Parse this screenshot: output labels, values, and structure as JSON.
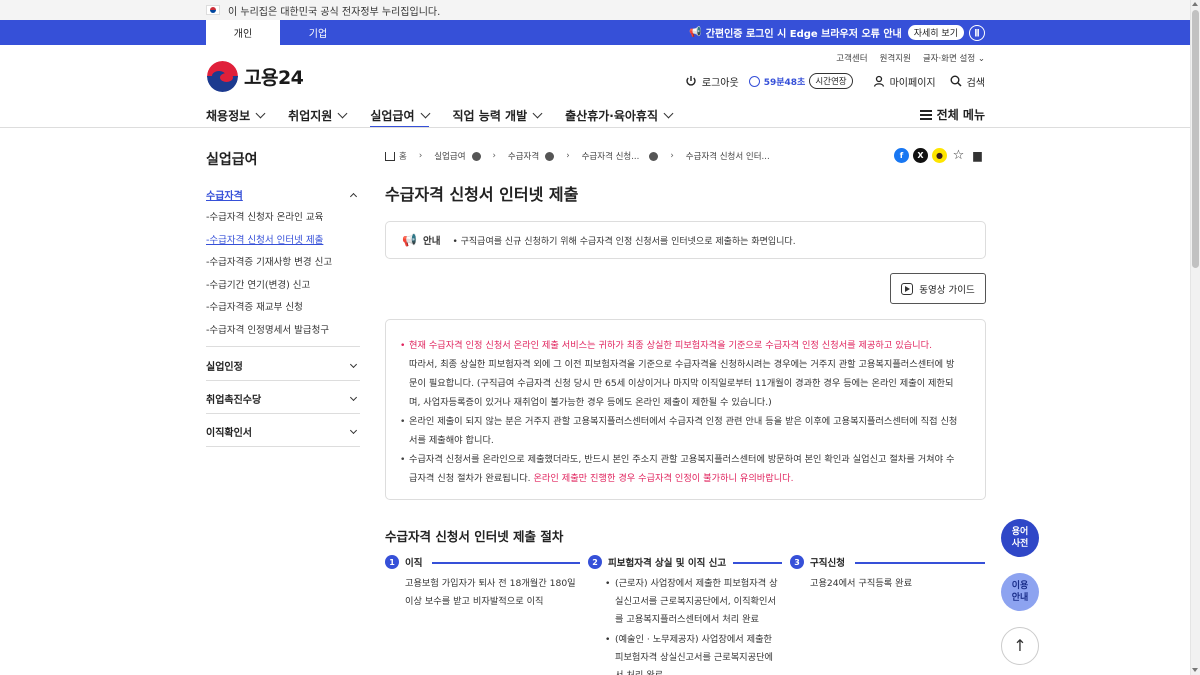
{
  "gov_banner": {
    "text": "이 누리집은 대한민국 공식 전자정부 누리집입니다."
  },
  "top_tabs": {
    "personal": "개인",
    "corporate": "기업"
  },
  "notice": {
    "text": "간편인증 로그인 시 Edge 브라우저 오류 안내",
    "detail_button": "자세히 보기",
    "pause_icon": "pause-icon"
  },
  "logo": {
    "text": "고용24"
  },
  "util_links": [
    "고객센터",
    "원격지원",
    "글자·화면 설정"
  ],
  "util": {
    "logout": "로그아웃",
    "timer": "59분48초",
    "extend": "시간연장",
    "mypage": "마이페이지",
    "search": "검색"
  },
  "main_nav": [
    {
      "label": "채용정보",
      "active": false
    },
    {
      "label": "취업지원",
      "active": false
    },
    {
      "label": "실업급여",
      "active": true
    },
    {
      "label": "직업 능력 개발",
      "active": false
    },
    {
      "label": "출산휴가·육아휴직",
      "active": false
    }
  ],
  "all_menu": "전체 메뉴",
  "sidebar": {
    "title": "실업급여",
    "sections": [
      {
        "label": "수급자격",
        "expanded": true
      },
      {
        "label": "실업인정",
        "expanded": false
      },
      {
        "label": "취업촉진수당",
        "expanded": false
      },
      {
        "label": "이직확인서",
        "expanded": false
      }
    ],
    "sub_items": [
      "-수급자격 신청자 온라인 교육",
      "-수급자격 신청서 인터넷 제출",
      "-수급자격증 기재사항 변경 신고",
      "-수급기간 연기(변경) 신고",
      "-수급자격증 재교부 신청",
      "-수급자격 인정명세서 발급청구"
    ],
    "current_sub": 1
  },
  "breadcrumb": [
    "홈",
    "실업급여",
    "수급자격",
    "수급자격 신청...",
    "수급자격 신청서 인터..."
  ],
  "share_icons": [
    {
      "name": "facebook-icon",
      "glyph": "f",
      "color": "#1877f2"
    },
    {
      "name": "x-icon",
      "glyph": "X",
      "color": "#111111"
    },
    {
      "name": "kakao-icon",
      "glyph": "●",
      "color": "#fee500"
    },
    {
      "name": "star-icon",
      "glyph": "☆",
      "color": "#ffffff"
    },
    {
      "name": "print-icon",
      "glyph": "▆",
      "color": "#ffffff"
    }
  ],
  "page_title": "수급자격 신청서 인터넷 제출",
  "guide": {
    "label": "안내",
    "text": "• 구직급여를 신규 신청하기 위해 수급자격 인정 신청서를 인터넷으로 제출하는 화면입니다."
  },
  "video_button": "동영상 가이드",
  "info": {
    "p1_red": "현재 수급자격 인정 신청서 온라인 제출 서비스는 귀하가 최종 상실한 피보험자격을 기준으로 수급자격 인정 신청서를 제공하고 있습니다.",
    "p1_line2": "따라서, 최종 상실한 피보험자격 외에 그 이전 피보험자격을 기준으로 수급자격을 신청하시려는 경우에는 거주지 관할 고용복지플러스센터에 방",
    "p1_line3": "문이 필요합니다. (구직급여 수급자격 신청 당시 만 65세 이상이거나 마지막 이직일로부터 11개월이 경과한 경우 등에는 온라인 제출이 제한되",
    "p1_line4": "며, 사업자등록증이 있거나 재취업이 불가능한 경우 등에도 온라인 제출이 제한될 수 있습니다.)",
    "p2_line1": "온라인 제출이 되지 않는 분은 거주지 관할 고용복지플러스센터에서 수급자격 인정 관련 안내 등을 받은 이후에 고용복지플러스센터에 직접 신청",
    "p2_line2": "서를 제출해야 합니다.",
    "p3_line1": "수급자격 신청서를 온라인으로 제출했더라도, 반드시 본인 주소지 관할 고용복지플러스센터에 방문하여 본인 확인과 실업신고 절차를 거쳐야 수",
    "p3_line2a": "급자격 신청 절차가 완료됩니다. ",
    "p3_line2b": "온라인 제출만 진행한 경우 수급자격 인정이 불가하니 유의바랍니다."
  },
  "procedure": {
    "title": "수급자격 신청서 인터넷 제출 절차",
    "steps": [
      {
        "num": "1",
        "label": "이직",
        "desc": [
          "고용보험 가입자가 퇴사 전 18개월간 180일",
          "이상 보수를 받고 비자발적으로 이직"
        ]
      },
      {
        "num": "2",
        "label": "피보험자격 상실 및 이직 신고",
        "bullets": [
          [
            "(근로자) 사업장에서 제출한 피보험자격 상",
            "실신고서를 근로복지공단에서, 이직확인서",
            "를 고용복지플러스센터에서 처리 완료"
          ],
          [
            "(예술인 · 노무제공자) 사업장에서 제출한",
            "피보험자격 상실신고서를 근로복지공단에",
            "서 처리 완료"
          ]
        ]
      },
      {
        "num": "3",
        "label": "구직신청",
        "desc": [
          "고용24에서 구직등록 완료"
        ]
      }
    ]
  },
  "floating": {
    "dictionary": [
      "용어",
      "사전"
    ],
    "guide": [
      "이용",
      "안내"
    ],
    "top": "↑"
  }
}
